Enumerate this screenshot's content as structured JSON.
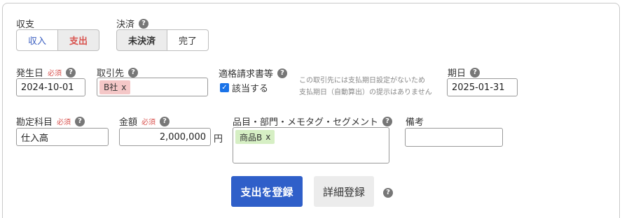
{
  "balance": {
    "label": "収支",
    "options": [
      "収入",
      "支出"
    ],
    "selected": "支出",
    "income_color": "#3a5ec0",
    "expense_color": "#d9534f"
  },
  "settlement": {
    "label": "決済",
    "options": [
      "未決済",
      "完了"
    ],
    "selected": "未決済"
  },
  "issue_date": {
    "label": "発生日",
    "required": "必須",
    "value": "2024-10-01"
  },
  "partner": {
    "label": "取引先",
    "tag": "B社",
    "tag_remove": "x",
    "tag_color": "#f4c7c7"
  },
  "invoice": {
    "label": "適格請求書等",
    "checkbox_label": "該当する",
    "checked": true,
    "note_line1": "この取引先には支払期日設定がないため",
    "note_line2": "支払期日（自動算出）の提示はありません"
  },
  "due_date": {
    "label": "期日",
    "value": "2025-01-31"
  },
  "account": {
    "label": "勘定科目",
    "required": "必須",
    "value": "仕入高"
  },
  "amount": {
    "label": "金額",
    "required": "必須",
    "value": "2,000,000",
    "unit": "円"
  },
  "item": {
    "label": "品目・部門・メモタグ・セグメント",
    "tag": "商品B",
    "tag_remove": "x",
    "tag_color": "#d6efc4"
  },
  "remarks": {
    "label": "備考",
    "value": ""
  },
  "actions": {
    "register": "支出を登録",
    "detail": "詳細登録",
    "help": "?"
  },
  "help_glyph": "?"
}
